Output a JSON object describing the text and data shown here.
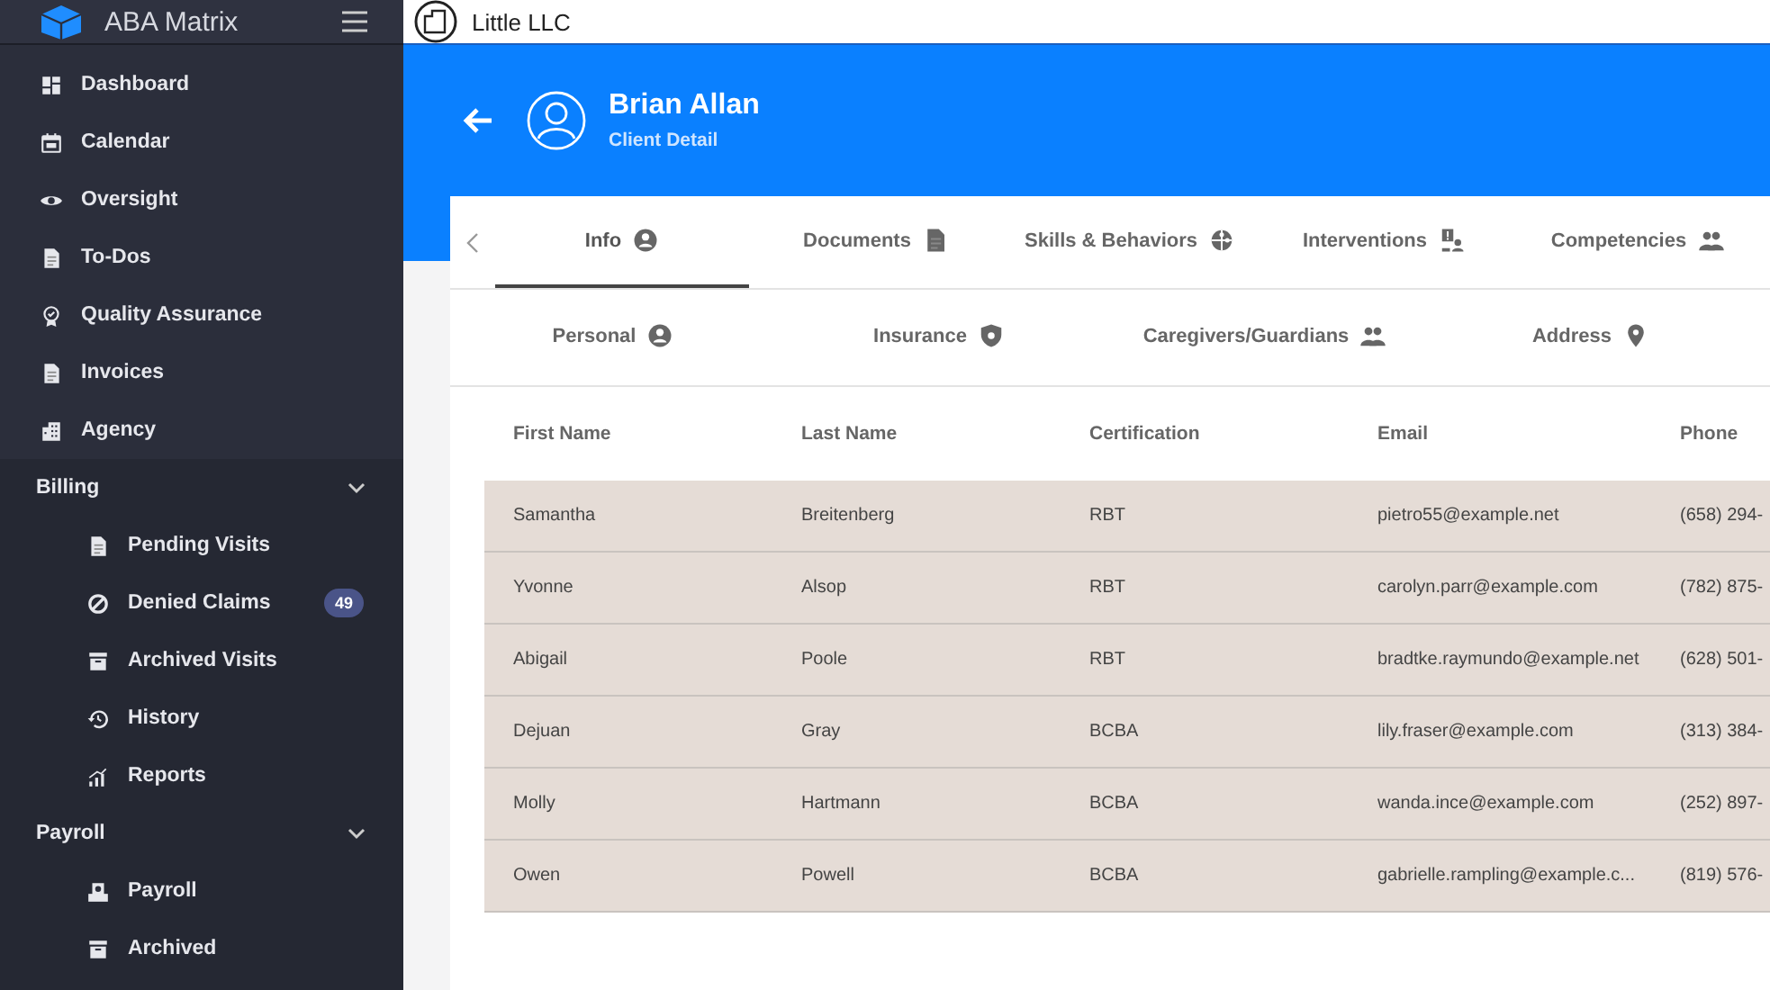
{
  "app": {
    "name": "ABA Matrix",
    "org": "Little LLC"
  },
  "sidebar": {
    "items": [
      {
        "label": "Dashboard"
      },
      {
        "label": "Calendar"
      },
      {
        "label": "Oversight"
      },
      {
        "label": "To-Dos"
      },
      {
        "label": "Quality Assurance"
      },
      {
        "label": "Invoices"
      },
      {
        "label": "Agency"
      }
    ],
    "sections": [
      {
        "label": "Billing",
        "expanded": true,
        "items": [
          {
            "label": "Pending Visits"
          },
          {
            "label": "Denied Claims",
            "badge": "49"
          },
          {
            "label": "Archived Visits"
          },
          {
            "label": "History"
          },
          {
            "label": "Reports"
          }
        ]
      },
      {
        "label": "Payroll",
        "expanded": true,
        "items": [
          {
            "label": "Payroll"
          },
          {
            "label": "Archived"
          }
        ]
      }
    ]
  },
  "client": {
    "name": "Brian Allan",
    "subtitle": "Client Detail"
  },
  "tabs": [
    {
      "label": "Info",
      "selected": true
    },
    {
      "label": "Documents",
      "selected": false
    },
    {
      "label": "Skills & Behaviors",
      "selected": false
    },
    {
      "label": "Interventions",
      "selected": false
    },
    {
      "label": "Competencies",
      "selected": false
    }
  ],
  "subtabs": [
    {
      "label": "Personal",
      "selected": false
    },
    {
      "label": "Insurance",
      "selected": false
    },
    {
      "label": "Caregivers/Guardians",
      "selected": false
    },
    {
      "label": "Address",
      "selected": false
    }
  ],
  "table": {
    "columns": [
      "First Name",
      "Last Name",
      "Certification",
      "Email",
      "Phone"
    ],
    "rows": [
      [
        "Samantha",
        "Breitenberg",
        "RBT",
        "pietro55@example.net",
        "(658) 294-"
      ],
      [
        "Yvonne",
        "Alsop",
        "RBT",
        "carolyn.parr@example.com",
        "(782) 875-"
      ],
      [
        "Abigail",
        "Poole",
        "RBT",
        "bradtke.raymundo@example.net",
        "(628) 501-"
      ],
      [
        "Dejuan",
        "Gray",
        "BCBA",
        "lily.fraser@example.com",
        "(313) 384-"
      ],
      [
        "Molly",
        "Hartmann",
        "BCBA",
        "wanda.ince@example.com",
        "(252) 897-"
      ],
      [
        "Owen",
        "Powell",
        "BCBA",
        "gabrielle.rampling@example.c...",
        "(819) 576-"
      ]
    ]
  }
}
